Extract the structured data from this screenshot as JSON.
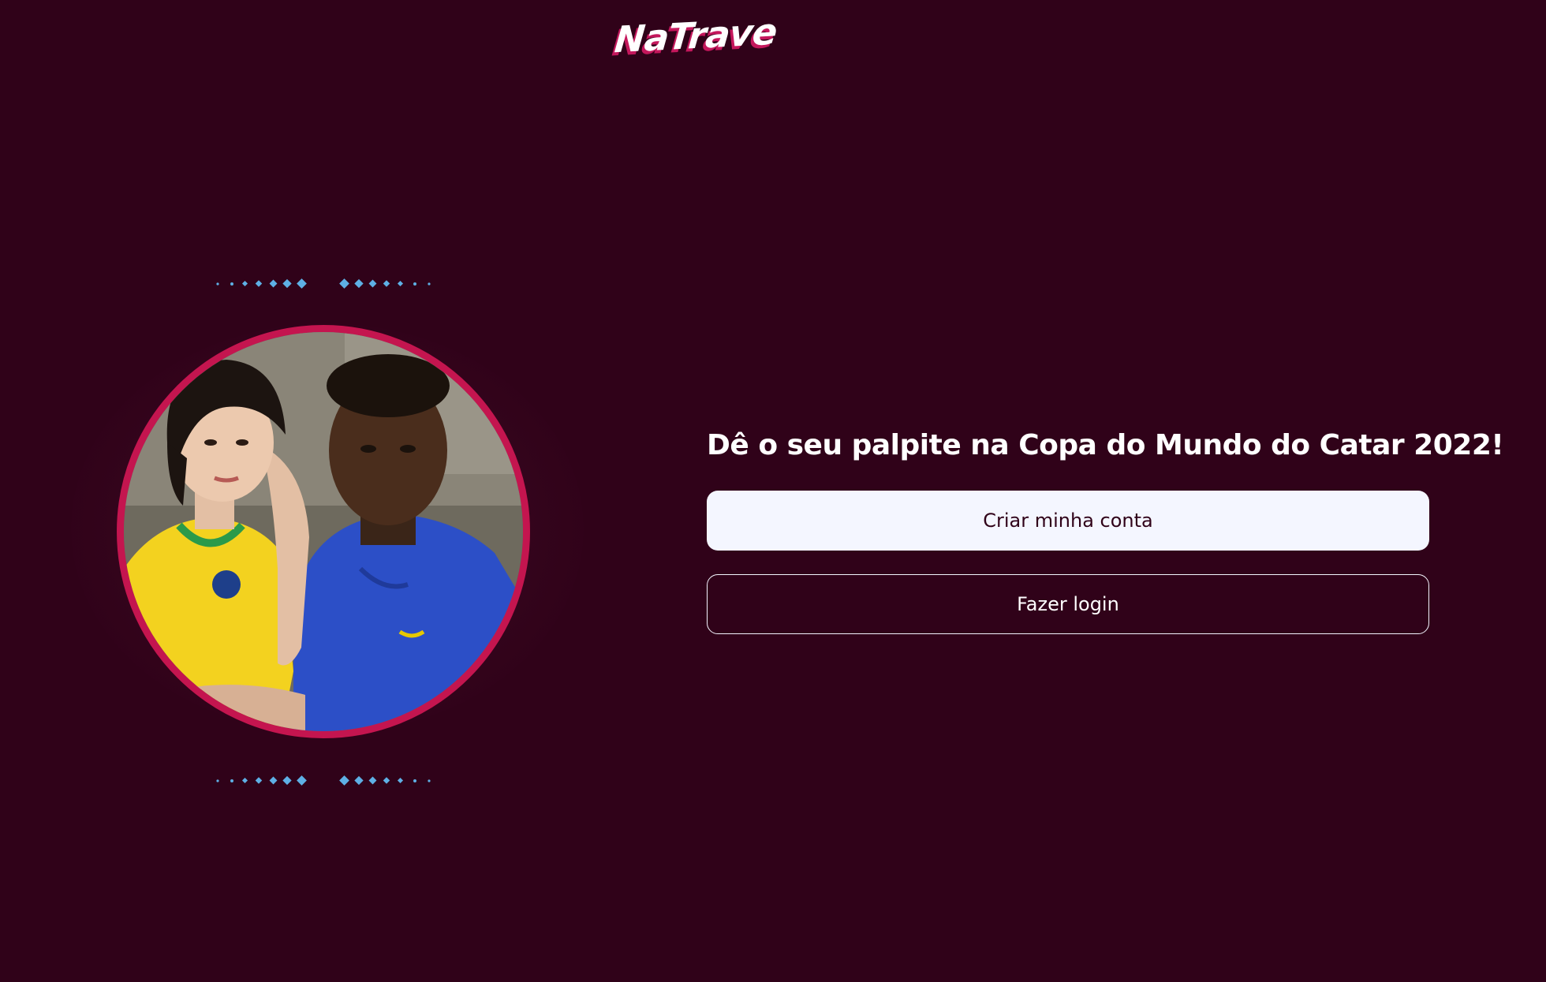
{
  "header": {
    "logo_text": "NaTrave"
  },
  "hero": {
    "image_alt": "Duas pessoas vestindo camisas da seleção brasileira"
  },
  "cta": {
    "headline": "Dê o seu palpite na Copa do Mundo do Catar 2022!",
    "signup_label": "Criar minha conta",
    "login_label": "Fazer login"
  },
  "colors": {
    "background": "#300219",
    "accent": "#c4154f",
    "light": "#f4f6ff",
    "dots": "#5eb0e5"
  }
}
